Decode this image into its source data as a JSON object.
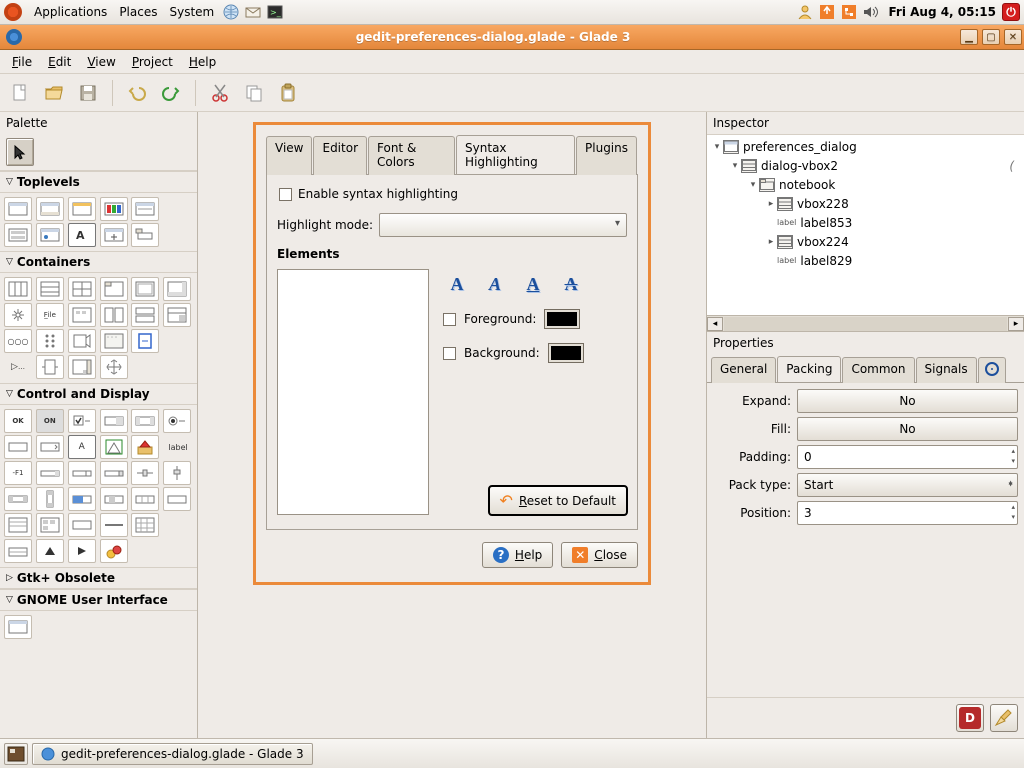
{
  "system_panel": {
    "menus": [
      "Applications",
      "Places",
      "System"
    ],
    "clock": "Fri Aug  4, 05:15"
  },
  "window": {
    "title": "gedit-preferences-dialog.glade - Glade 3"
  },
  "menubar": {
    "file": "File",
    "edit": "Edit",
    "view": "View",
    "project": "Project",
    "help": "Help"
  },
  "palette": {
    "title": "Palette",
    "sections": {
      "toplevels": "Toplevels",
      "containers": "Containers",
      "control": "Control and Display",
      "obsolete": "Gtk+ Obsolete",
      "gnome": "GNOME User Interface"
    }
  },
  "design": {
    "tabs": [
      "View",
      "Editor",
      "Font & Colors",
      "Syntax Highlighting",
      "Plugins"
    ],
    "active_tab": 3,
    "enable_syntax": "Enable syntax highlighting",
    "highlight_mode_label": "Highlight mode:",
    "elements_label": "Elements",
    "foreground_label": "Foreground:",
    "background_label": "Background:",
    "reset_label": "Reset to Default",
    "help_label": "Help",
    "close_label": "Close",
    "underline_positions": {
      "reset": 0,
      "help": 0,
      "close": 0
    }
  },
  "inspector": {
    "title": "Inspector",
    "tree": [
      {
        "depth": 0,
        "expander": "▾",
        "icon": "window",
        "label": "preferences_dialog",
        "trail": ""
      },
      {
        "depth": 1,
        "expander": "▾",
        "icon": "vbox",
        "label": "dialog-vbox2",
        "trail": "("
      },
      {
        "depth": 2,
        "expander": "▾",
        "icon": "notebook",
        "label": "notebook",
        "trail": ""
      },
      {
        "depth": 3,
        "expander": "▸",
        "icon": "vbox",
        "label": "vbox228",
        "trail": ""
      },
      {
        "depth": 3,
        "expander": "",
        "icon": "label",
        "label": "label853",
        "trail": ""
      },
      {
        "depth": 3,
        "expander": "▸",
        "icon": "vbox",
        "label": "vbox224",
        "trail": ""
      },
      {
        "depth": 3,
        "expander": "",
        "icon": "label",
        "label": "label829",
        "trail": ""
      }
    ]
  },
  "properties": {
    "title": "Properties",
    "tabs": [
      "General",
      "Packing",
      "Common",
      "Signals"
    ],
    "active_tab": 1,
    "rows": {
      "expand": {
        "label": "Expand:",
        "value": "No"
      },
      "fill": {
        "label": "Fill:",
        "value": "No"
      },
      "padding": {
        "label": "Padding:",
        "value": "0"
      },
      "pack_type": {
        "label": "Pack type:",
        "value": "Start"
      },
      "position": {
        "label": "Position:",
        "value": "3"
      }
    }
  },
  "taskbar": {
    "task1": "gedit-preferences-dialog.glade - Glade 3"
  }
}
